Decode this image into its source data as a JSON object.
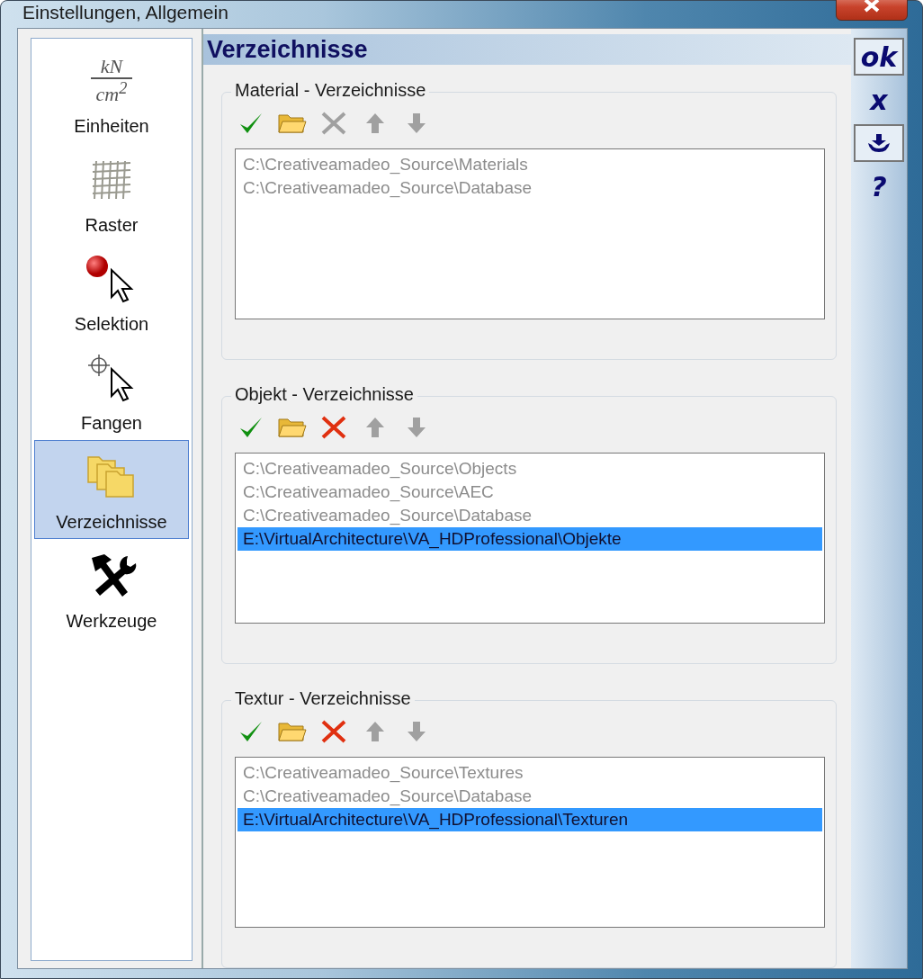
{
  "window": {
    "title": "Einstellungen, Allgemein"
  },
  "sidebar": {
    "items": [
      {
        "kind": "units",
        "label": "Einheiten",
        "selected": false,
        "numerator": "kN",
        "denominator": "cm$^{2}$"
      },
      {
        "kind": "grid",
        "label": "Raster",
        "selected": false
      },
      {
        "kind": "selection",
        "label": "Selektion",
        "selected": false
      },
      {
        "kind": "snap",
        "label": "Fangen",
        "selected": false
      },
      {
        "kind": "folders",
        "label": "Verzeichnisse",
        "selected": true
      },
      {
        "kind": "tools",
        "label": "Werkzeuge",
        "selected": false
      }
    ]
  },
  "header": "Verzeichnisse",
  "groups": [
    {
      "title": "Material - Verzeichnisse",
      "tools": [
        {
          "kind": "check",
          "disabled": false
        },
        {
          "kind": "folder",
          "disabled": false
        },
        {
          "kind": "delete",
          "disabled": true
        },
        {
          "kind": "up",
          "disabled": true
        },
        {
          "kind": "down",
          "disabled": true
        }
      ],
      "items": [
        {
          "path": "C:\\Creativeamadeo_Source\\Materials",
          "disabled": true,
          "selected": false
        },
        {
          "path": "C:\\Creativeamadeo_Source\\Database",
          "disabled": true,
          "selected": false
        }
      ]
    },
    {
      "title": "Objekt - Verzeichnisse",
      "tools": [
        {
          "kind": "check",
          "disabled": false
        },
        {
          "kind": "folder",
          "disabled": false
        },
        {
          "kind": "delete",
          "disabled": false
        },
        {
          "kind": "up",
          "disabled": true
        },
        {
          "kind": "down",
          "disabled": true
        }
      ],
      "items": [
        {
          "path": "C:\\Creativeamadeo_Source\\Objects",
          "disabled": true,
          "selected": false
        },
        {
          "path": "C:\\Creativeamadeo_Source\\AEC",
          "disabled": true,
          "selected": false
        },
        {
          "path": "C:\\Creativeamadeo_Source\\Database",
          "disabled": true,
          "selected": false
        },
        {
          "path": "E:\\VirtualArchitecture\\VA_HDProfessional\\Objekte",
          "disabled": false,
          "selected": true
        }
      ]
    },
    {
      "title": "Textur - Verzeichnisse",
      "tools": [
        {
          "kind": "check",
          "disabled": false
        },
        {
          "kind": "folder",
          "disabled": false
        },
        {
          "kind": "delete",
          "disabled": false
        },
        {
          "kind": "up",
          "disabled": true
        },
        {
          "kind": "down",
          "disabled": true
        }
      ],
      "items": [
        {
          "path": "C:\\Creativeamadeo_Source\\Textures",
          "disabled": true,
          "selected": false
        },
        {
          "path": "C:\\Creativeamadeo_Source\\Database",
          "disabled": true,
          "selected": false
        },
        {
          "path": "E:\\VirtualArchitecture\\VA_HDProfessional\\Texturen",
          "disabled": false,
          "selected": true
        }
      ]
    }
  ],
  "actions": [
    {
      "kind": "text",
      "label": "ok",
      "framed": true
    },
    {
      "kind": "text",
      "label": "x",
      "framed": false
    },
    {
      "kind": "anchor",
      "framed": true
    },
    {
      "kind": "text",
      "label": "?",
      "framed": false
    }
  ]
}
